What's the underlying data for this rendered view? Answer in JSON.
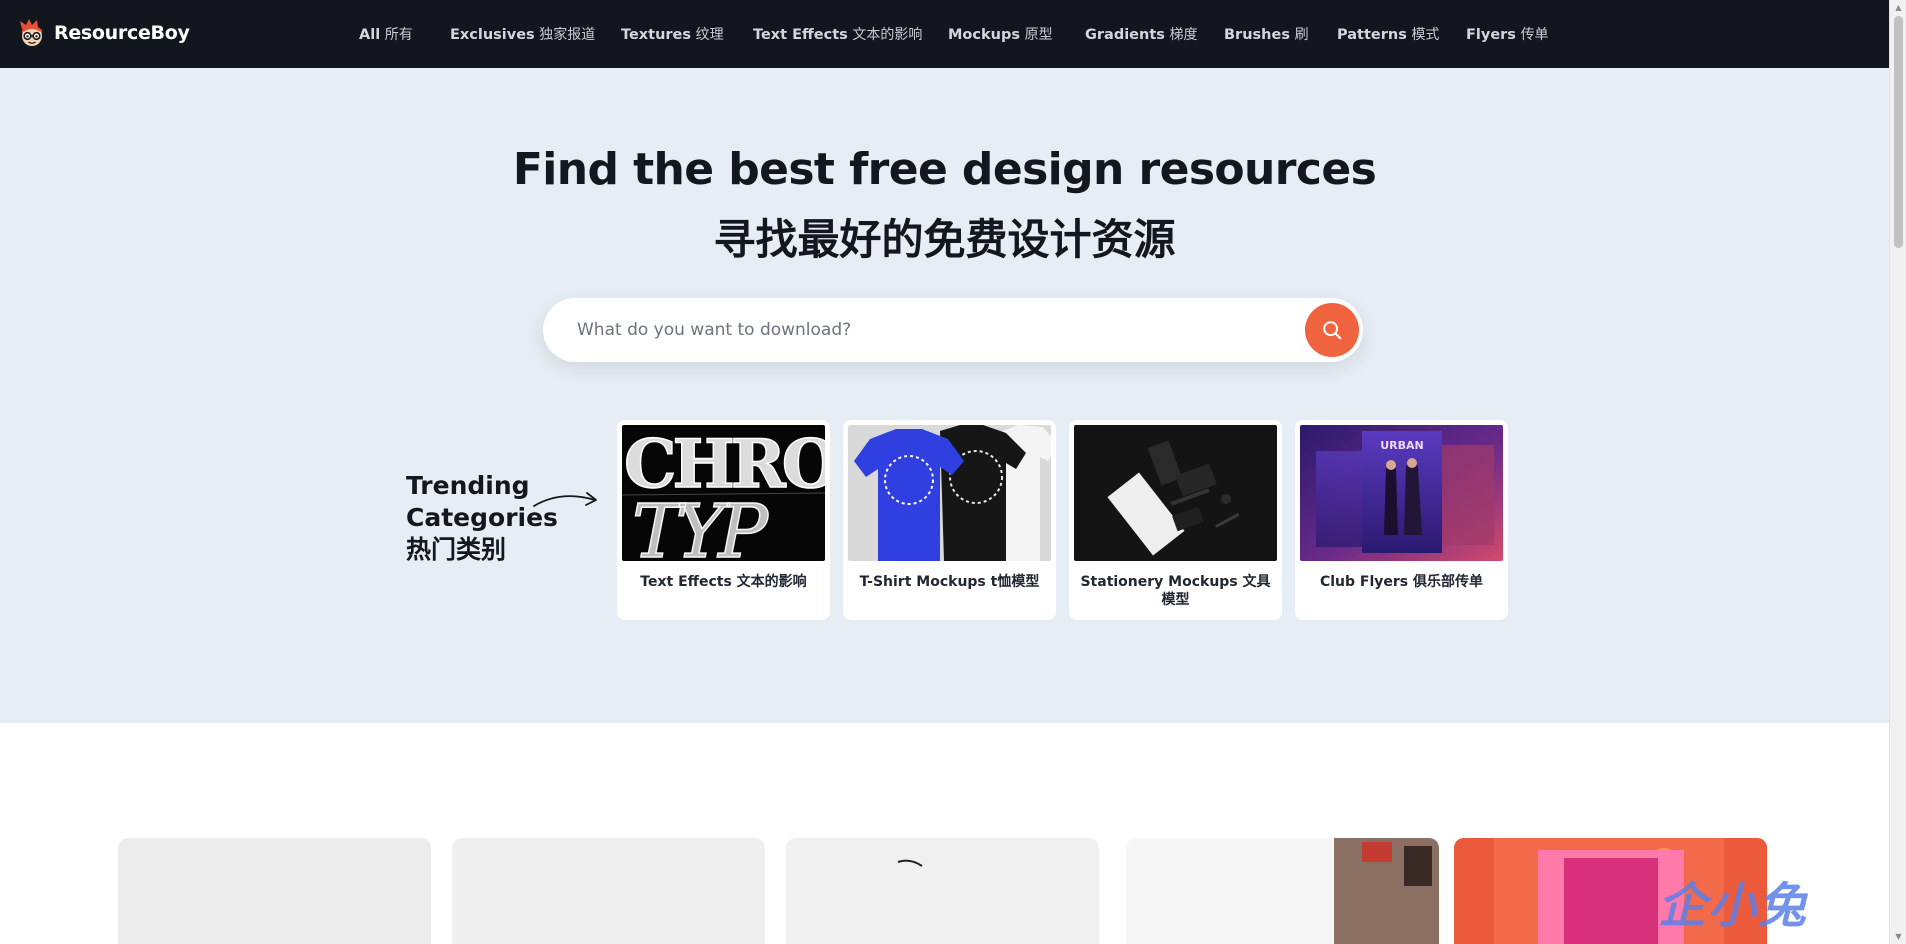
{
  "brand": {
    "name": "ResourceBoy"
  },
  "nav": {
    "items": [
      {
        "en": "All",
        "zh": "所有"
      },
      {
        "en": "Exclusives",
        "zh": "独家报道"
      },
      {
        "en": "Textures",
        "zh": "纹理"
      },
      {
        "en": "Text Effects",
        "zh": "文本的影响"
      },
      {
        "en": "Mockups",
        "zh": "原型"
      },
      {
        "en": "Gradients",
        "zh": "梯度"
      },
      {
        "en": "Brushes",
        "zh": "刷"
      },
      {
        "en": "Patterns",
        "zh": "模式"
      },
      {
        "en": "Flyers",
        "zh": "传单"
      }
    ]
  },
  "hero": {
    "title": "Find the best free design resources",
    "subtitle": "寻找最好的免费设计资源"
  },
  "search": {
    "placeholder": "What do you want to download?",
    "button_icon": "search-icon"
  },
  "trending": {
    "label_line1": "Trending",
    "label_line2": "Categories",
    "label_line3": "热门类别",
    "categories": [
      {
        "label": "Text Effects 文本的影响"
      },
      {
        "label": "T-Shirt Mockups t恤模型"
      },
      {
        "label": "Stationery Mockups 文具模型"
      },
      {
        "label": "Club Flyers 俱乐部传单"
      }
    ]
  },
  "watermark": "企小兔",
  "colors": {
    "nav_bg": "#12171f",
    "hero_bg": "#e6edf4",
    "accent": "#f0633f",
    "text_dark": "#13171f"
  }
}
